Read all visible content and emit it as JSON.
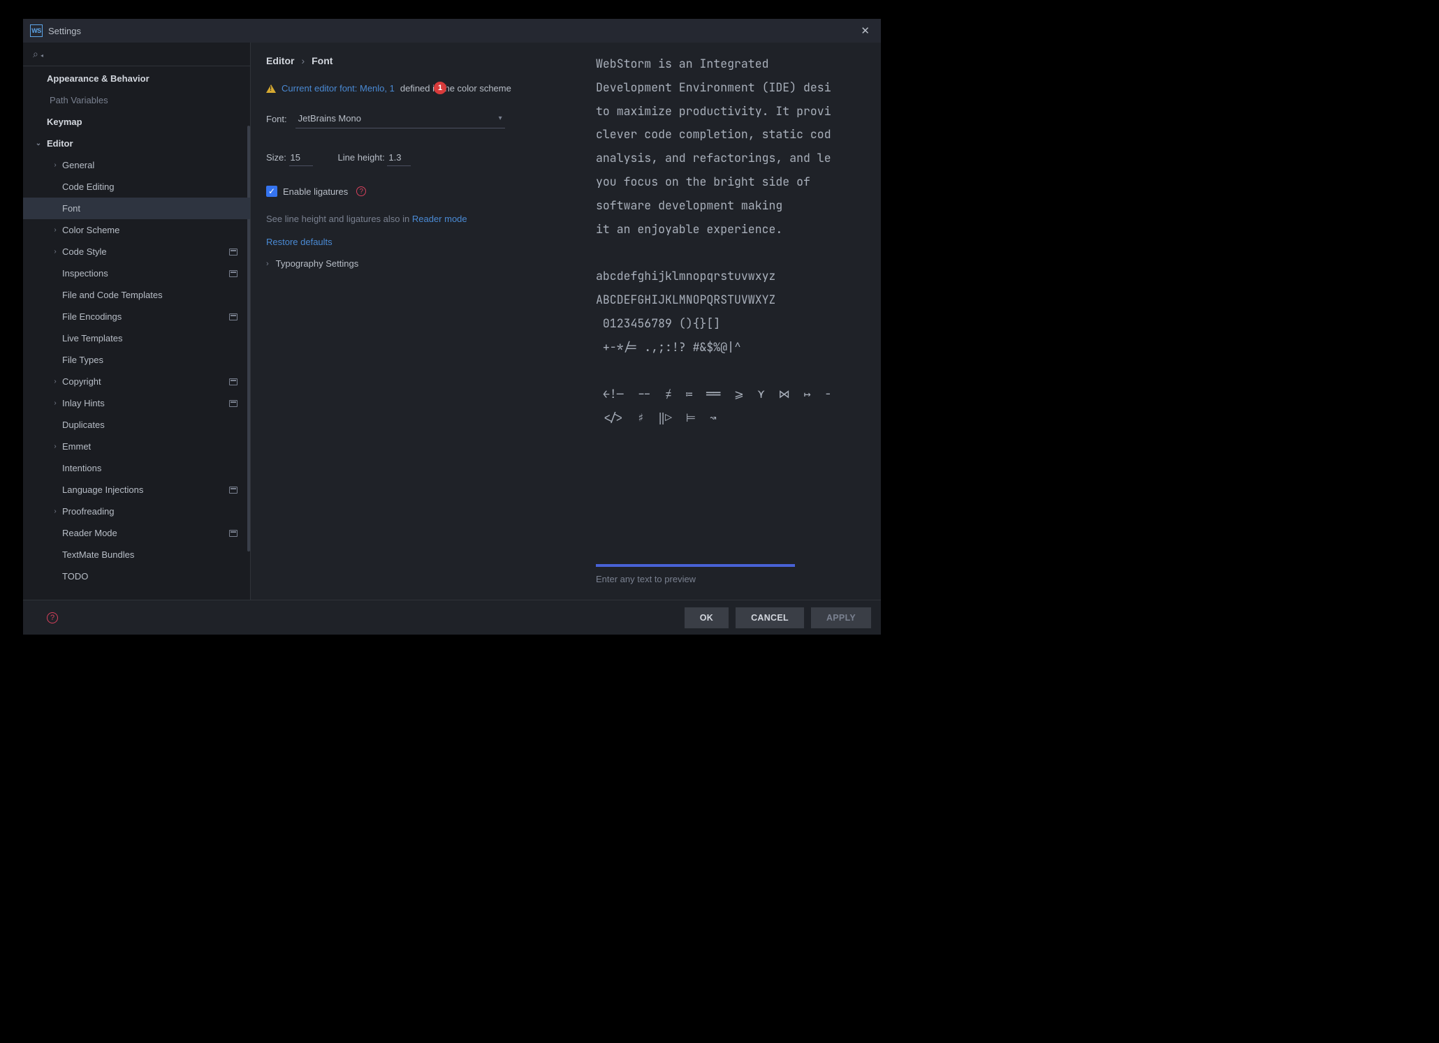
{
  "titlebar": {
    "logo": "WS",
    "title": "Settings"
  },
  "sidebar": {
    "items": [
      {
        "label": "Appearance & Behavior",
        "kind": "top",
        "chev": ""
      },
      {
        "label": "Path Variables",
        "kind": "dim"
      },
      {
        "label": "Keymap",
        "kind": "top"
      },
      {
        "label": "Editor",
        "kind": "top",
        "chev": "⌄"
      },
      {
        "label": "General",
        "kind": "sub",
        "chev": "›"
      },
      {
        "label": "Code Editing",
        "kind": "sub"
      },
      {
        "label": "Font",
        "kind": "sub",
        "selected": true
      },
      {
        "label": "Color Scheme",
        "kind": "sub",
        "chev": "›"
      },
      {
        "label": "Code Style",
        "kind": "sub",
        "chev": "›",
        "badge": true
      },
      {
        "label": "Inspections",
        "kind": "sub",
        "badge": true
      },
      {
        "label": "File and Code Templates",
        "kind": "sub"
      },
      {
        "label": "File Encodings",
        "kind": "sub",
        "badge": true
      },
      {
        "label": "Live Templates",
        "kind": "sub"
      },
      {
        "label": "File Types",
        "kind": "sub"
      },
      {
        "label": "Copyright",
        "kind": "sub",
        "chev": "›",
        "badge": true
      },
      {
        "label": "Inlay Hints",
        "kind": "sub",
        "chev": "›",
        "badge": true
      },
      {
        "label": "Duplicates",
        "kind": "sub"
      },
      {
        "label": "Emmet",
        "kind": "sub",
        "chev": "›"
      },
      {
        "label": "Intentions",
        "kind": "sub"
      },
      {
        "label": "Language Injections",
        "kind": "sub",
        "badge": true
      },
      {
        "label": "Proofreading",
        "kind": "sub",
        "chev": "›"
      },
      {
        "label": "Reader Mode",
        "kind": "sub",
        "badge": true
      },
      {
        "label": "TextMate Bundles",
        "kind": "sub"
      },
      {
        "label": "TODO",
        "kind": "sub"
      }
    ]
  },
  "breadcrumb": {
    "a": "Editor",
    "sep": "›",
    "b": "Font"
  },
  "warning": {
    "link_text": "Current editor font: Menlo, 1",
    "tail": "defined in the color scheme",
    "badge": "1"
  },
  "form": {
    "font_label": "Font:",
    "font_value": "JetBrains Mono",
    "size_label": "Size:",
    "size_value": "15",
    "lineheight_label": "Line height:",
    "lineheight_value": "1.3",
    "ligatures_label": "Enable ligatures",
    "reader_hint_prefix": "See line height and ligatures also in ",
    "reader_hint_link": "Reader mode",
    "restore": "Restore defaults",
    "typo": "Typography Settings"
  },
  "preview": {
    "text": "WebStorm is an Integrated\nDevelopment Environment (IDE) desi\nto maximize productivity. It provi\nclever code completion, static cod\nanalysis, and refactorings, and le\nyou focus on the bright side of\nsoftware development making\nit an enjoyable experience.\n\nabcdefghijklmnopqrstuvwxyz\nABCDEFGHIJKLMNOPQRSTUVWXYZ\n 0123456789 (){}[]\n +-*/= .,;:!? #&$%@|^\n\n ←!—  --  ≠  ≔  ══  ⩾  ⋎  ⋈  ↦  -\n </>  ♯  ‖▷  ⊨  ↝",
    "hint": "Enter any text to preview"
  },
  "footer": {
    "ok": "OK",
    "cancel": "CANCEL",
    "apply": "APPLY"
  }
}
